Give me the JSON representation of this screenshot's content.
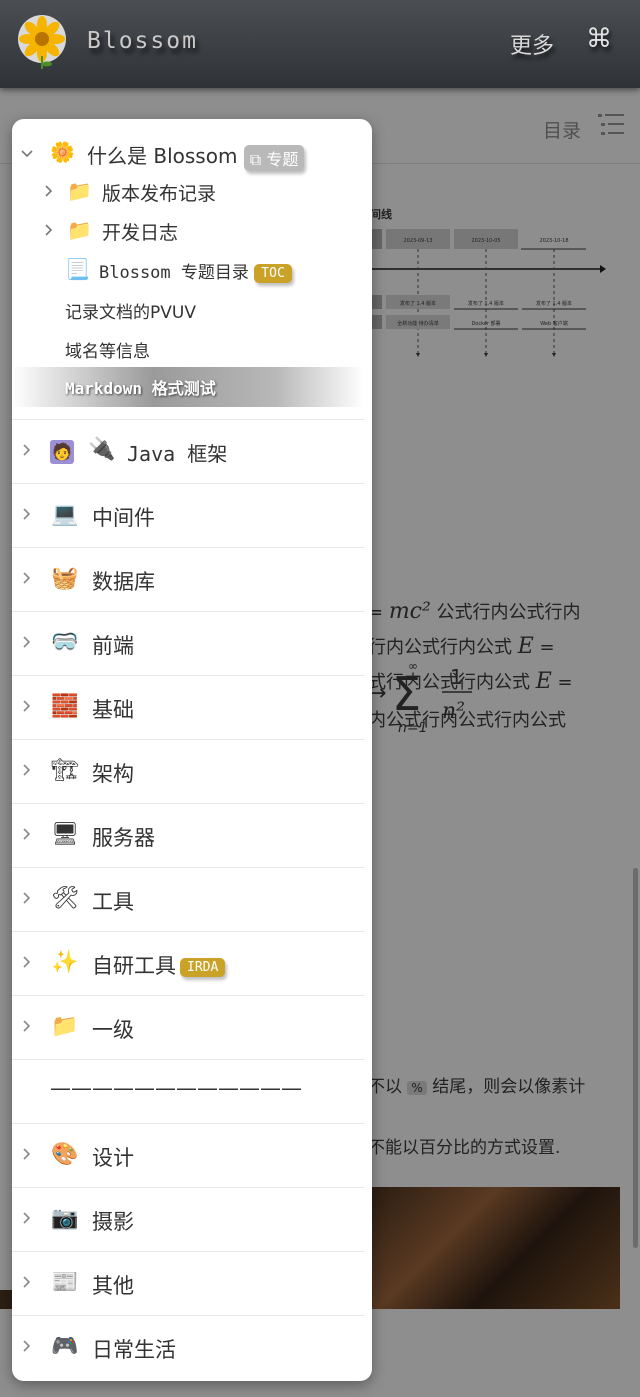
{
  "header": {
    "brand": "Blossom",
    "more_label": "更多",
    "command_glyph": "⌘"
  },
  "article_bg": {
    "toc_label": "目录",
    "timeline_title": "间线",
    "timeline_dates": [
      "2023-09-13",
      "2023-10-05",
      "2023-10-18"
    ],
    "timeline_notes": [
      "发布了 1.4 版本",
      "发布了 1.4 版本",
      "发布了 1.4 版本",
      "全新功能 待办清单",
      "Docker 部署",
      "Web 客户端"
    ],
    "formula_lines": [
      {
        "pre": "= ",
        "math": "mc²",
        "post": " 公式行内公式行内"
      },
      {
        "pre": "行内公式行内公式 ",
        "math": "E",
        "post": " ="
      },
      {
        "pre": "式行内公式行内公式 ",
        "math": "E",
        "post": " ="
      },
      {
        "pre": "内公式行内公式行内公式",
        "math": "",
        "post": ""
      }
    ],
    "sum_formula": {
      "upper": "∞",
      "lower": "n=1",
      "numer": "1",
      "denom": "n²"
    },
    "note1": {
      "pre": "不以 ",
      "code": "%",
      "post": " 结尾，则会以像素计"
    },
    "note2": "不能以百分比的方式设置."
  },
  "drawer": {
    "root": {
      "label": "什么是 Blossom",
      "badge": "专题",
      "emoji": "🌼"
    },
    "children": [
      {
        "label": "版本发布记录",
        "emoji": "📁"
      },
      {
        "label": "开发日志",
        "emoji": "📁"
      }
    ],
    "toc_item": {
      "label": "Blossom 专题目录",
      "badge": "TOC",
      "emoji": "📃"
    },
    "plain_items": [
      "记录文档的PVUV",
      "域名等信息"
    ],
    "active_item": "Markdown 格式测试",
    "sections": [
      {
        "label": "Java 框架",
        "emoji": "🔌",
        "avatar": true
      },
      {
        "label": "中间件",
        "emoji": "💻"
      },
      {
        "label": "数据库",
        "emoji": "🧺"
      },
      {
        "label": "前端",
        "emoji": "🥽"
      },
      {
        "label": "基础",
        "emoji": "🧱"
      },
      {
        "label": "架构",
        "emoji": "🏗"
      },
      {
        "label": "服务器",
        "emoji": "🖥"
      },
      {
        "label": "工具",
        "emoji": "🛠"
      },
      {
        "label": "自研工具",
        "emoji": "✨",
        "badge": "IRDA"
      },
      {
        "label": "一级",
        "emoji": "📁"
      },
      {
        "label": "————————————",
        "emoji": ""
      },
      {
        "label": "设计",
        "emoji": "🎨"
      },
      {
        "label": "摄影",
        "emoji": "📷"
      },
      {
        "label": "其他",
        "emoji": "📰"
      },
      {
        "label": "日常生活",
        "emoji": "🎮"
      }
    ]
  },
  "colors": {
    "header_bg": "#3a3d41",
    "badge_gold": "#c9a227",
    "badge_gray": "#b9b9b9",
    "overlay": "#8e8e8e"
  }
}
